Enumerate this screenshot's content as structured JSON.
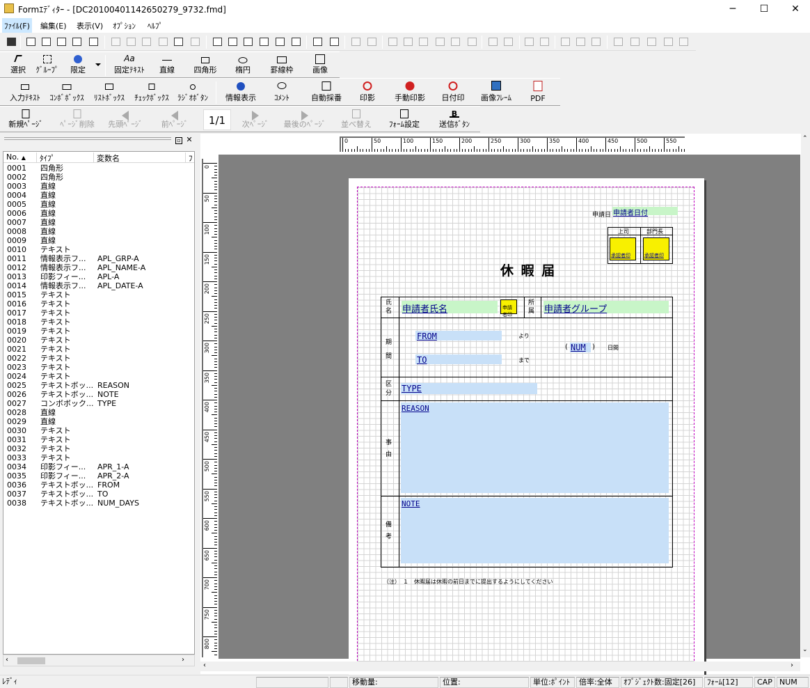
{
  "window": {
    "title": "Formｴﾃﾞｨﾀｰ - [DC20100401142650279_9732.fmd]",
    "min": "─",
    "max": "☐",
    "close": "✕"
  },
  "menu": {
    "file": "ﾌｧｲﾙ(F)",
    "edit": "編集(E)",
    "view": "表示(V)",
    "options": "ｵﾌﾟｼｮﾝ",
    "help": "ﾍﾙﾌﾟ"
  },
  "tools": {
    "select": "選択",
    "group": "ｸﾞﾙｰﾌﾟ",
    "limit": "限定",
    "fixed_text": "固定ﾃｷｽﾄ",
    "line": "直線",
    "rectangle": "四角形",
    "ellipse": "楕円",
    "table_frame": "罫線枠",
    "image": "画像"
  },
  "fields": {
    "input_text": "入力ﾃｷｽﾄ",
    "combobox": "ｺﾝﾎﾞﾎﾞｯｸｽ",
    "listbox": "ﾘｽﾄﾎﾞｯｸｽ",
    "checkbox": "ﾁｪｯｸﾎﾞｯｸｽ",
    "radio": "ﾗｼﾞｵﾎﾞﾀﾝ",
    "info_display": "情報表示",
    "comment": "ｺﾒﾝﾄ",
    "auto_number": "自動採番",
    "stamp": "印影",
    "manual_stamp": "手動印影",
    "date_stamp": "日付印",
    "image_frame": "画像ﾌﾚｰﾑ",
    "pdf": "PDF"
  },
  "pages": {
    "new": "新規ﾍﾟｰｼﾞ",
    "delete": "ﾍﾟｰｼﾞ削除",
    "first": "先頭ﾍﾟｰｼﾞ",
    "prev": "前ﾍﾟｰｼﾞ",
    "indicator": "1/1",
    "next": "次ﾍﾟｰｼﾞ",
    "last": "最後のﾍﾟｰｼﾞ",
    "sort": "並べ替え",
    "form_settings": "ﾌｫｰﾑ設定",
    "send_button": "送信ﾎﾞﾀﾝ"
  },
  "list": {
    "columns": [
      "No.",
      "ﾀｲﾌﾟ",
      "変数名",
      "ﾌ"
    ],
    "rows": [
      [
        "0001",
        "四角形",
        ""
      ],
      [
        "0002",
        "四角形",
        ""
      ],
      [
        "0003",
        "直線",
        ""
      ],
      [
        "0004",
        "直線",
        ""
      ],
      [
        "0005",
        "直線",
        ""
      ],
      [
        "0006",
        "直線",
        ""
      ],
      [
        "0007",
        "直線",
        ""
      ],
      [
        "0008",
        "直線",
        ""
      ],
      [
        "0009",
        "直線",
        ""
      ],
      [
        "0010",
        "テキスト",
        ""
      ],
      [
        "0011",
        "情報表示フ...",
        "APL_GRP-A"
      ],
      [
        "0012",
        "情報表示フ...",
        "APL_NAME-A"
      ],
      [
        "0013",
        "印影フィー...",
        "APL-A"
      ],
      [
        "0014",
        "情報表示フ...",
        "APL_DATE-A"
      ],
      [
        "0015",
        "テキスト",
        ""
      ],
      [
        "0016",
        "テキスト",
        ""
      ],
      [
        "0017",
        "テキスト",
        ""
      ],
      [
        "0018",
        "テキスト",
        ""
      ],
      [
        "0019",
        "テキスト",
        ""
      ],
      [
        "0020",
        "テキスト",
        ""
      ],
      [
        "0021",
        "テキスト",
        ""
      ],
      [
        "0022",
        "テキスト",
        ""
      ],
      [
        "0023",
        "テキスト",
        ""
      ],
      [
        "0024",
        "テキスト",
        ""
      ],
      [
        "0025",
        "テキストボッ...",
        "REASON"
      ],
      [
        "0026",
        "テキストボッ...",
        "NOTE"
      ],
      [
        "0027",
        "コンボボック...",
        "TYPE"
      ],
      [
        "0028",
        "直線",
        ""
      ],
      [
        "0029",
        "直線",
        ""
      ],
      [
        "0030",
        "テキスト",
        ""
      ],
      [
        "0031",
        "テキスト",
        ""
      ],
      [
        "0032",
        "テキスト",
        ""
      ],
      [
        "0033",
        "テキスト",
        ""
      ],
      [
        "0034",
        "印影フィー...",
        "APR_1-A"
      ],
      [
        "0035",
        "印影フィー...",
        "APR_2-A"
      ],
      [
        "0036",
        "テキストボッ...",
        "FROM"
      ],
      [
        "0037",
        "テキストボッ...",
        "TO"
      ],
      [
        "0038",
        "テキストボッ...",
        "NUM_DAYS"
      ]
    ]
  },
  "ruler": {
    "top": [
      "0",
      "50",
      "100",
      "150",
      "200",
      "250",
      "300",
      "350",
      "400",
      "450",
      "500",
      "550"
    ],
    "left": [
      "0",
      "50",
      "100",
      "150",
      "200",
      "250",
      "300",
      "350",
      "400",
      "450",
      "500",
      "550",
      "600",
      "650",
      "700",
      "750",
      "800"
    ]
  },
  "form": {
    "apply_date_label": "申請日",
    "apply_date_field": "申請者日付",
    "boss_label": "上司",
    "dept_label": "部門長",
    "approval_stamp": "承認者印",
    "title": "休 暇 届",
    "name_label": "氏名",
    "name_field": "申請者氏名",
    "applicant_stamp": "申請者印",
    "dept_field_label": "所属",
    "group_field": "申請者グループ",
    "period_label": "期間",
    "from_field": "FROM",
    "from_suffix": "より",
    "to_field": "TO",
    "to_suffix": "まで",
    "num_open": "(",
    "num_field": "NUM",
    "num_close": ")",
    "days_label": "日間",
    "category_label": "区分",
    "type_field": "TYPE",
    "reason_label": "事由",
    "reason_field": "REASON",
    "note_label": "備考",
    "note_field": "NOTE",
    "footnote": "（注）　１　休暇届は休暇の前日までに提出するようにしてください"
  },
  "status": {
    "ready": "ﾚﾃﾞｨ",
    "move": "移動量:",
    "position": "位置:",
    "unit": "単位:ﾎﾟｲﾝﾄ",
    "zoom": "倍率:全体",
    "objects": "ｵﾌﾞｼﾞｪｸﾄ数:固定[26]",
    "form": "ﾌｫｰﾑ[12]",
    "cap": "CAP",
    "num": "NUM"
  }
}
